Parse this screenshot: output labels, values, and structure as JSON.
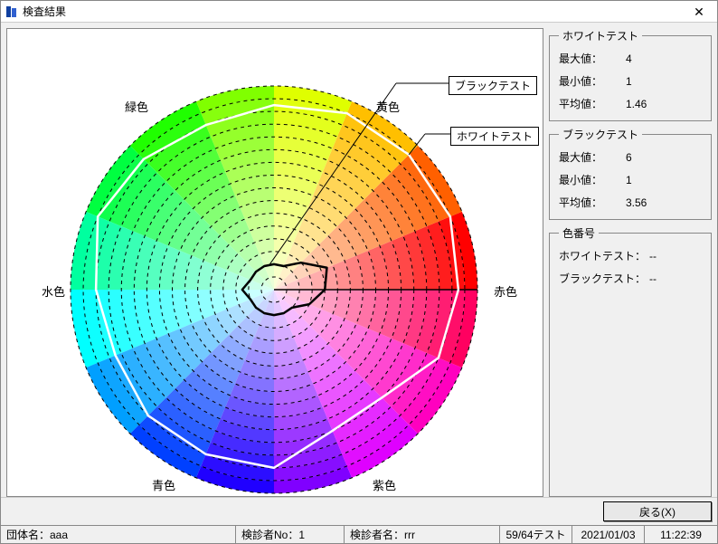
{
  "window": {
    "title": "検査結果"
  },
  "white_test": {
    "legend": "ホワイトテスト",
    "max_label": "最大値：",
    "max_value": "4",
    "min_label": "最小値：",
    "min_value": "1",
    "avg_label": "平均値：",
    "avg_value": "1.46"
  },
  "black_test": {
    "legend": "ブラックテスト",
    "max_label": "最大値：",
    "max_value": "6",
    "min_label": "最小値：",
    "min_value": "1",
    "avg_label": "平均値：",
    "avg_value": "3.56"
  },
  "color_no": {
    "legend": "色番号",
    "white_label": "ホワイトテスト：",
    "white_value": "--",
    "black_label": "ブラックテスト：",
    "black_value": "--"
  },
  "buttons": {
    "back": "戻る(X)"
  },
  "status": {
    "group": "団体名：aaa",
    "examiner_no": "検診者No：1",
    "examiner_name": "検診者名：rrr",
    "progress": "59/64テスト",
    "date": "2021/01/03",
    "time": "11:22:39"
  },
  "chart_labels": {
    "red": "赤色",
    "yellow": "黄色",
    "green": "緑色",
    "cyan": "水色",
    "blue": "青色",
    "purple": "紫色",
    "black_test": "ブラックテスト",
    "white_test": "ホワイトテスト"
  },
  "chart_data": {
    "type": "radar",
    "title": "検査結果",
    "rings": 16,
    "segments": 16,
    "color_scheme": "hue-wheel",
    "axis_labels": [
      "赤色",
      "黄色",
      "緑色",
      "水色",
      "青色",
      "紫色"
    ],
    "series": [
      {
        "name": "ホワイトテスト",
        "stroke": "#ffffff",
        "range": [
          0,
          16
        ],
        "values_estimated": [
          14.5,
          15,
          15,
          15,
          14.5,
          14,
          14.5,
          15,
          14,
          13.5,
          14,
          14,
          14,
          12,
          12,
          14
        ]
      },
      {
        "name": "ブラックテスト",
        "stroke": "#000000",
        "range": [
          0,
          16
        ],
        "values_estimated": [
          4,
          4.5,
          3,
          2,
          2,
          2,
          2,
          2,
          2.5,
          2,
          2,
          2,
          2,
          2,
          2,
          3
        ]
      }
    ]
  }
}
